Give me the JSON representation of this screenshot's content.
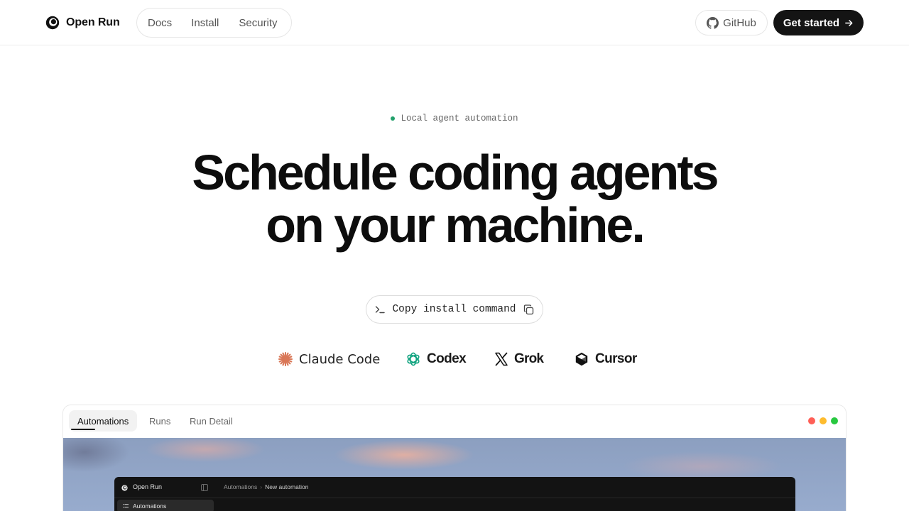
{
  "header": {
    "brand_name": "Open Run",
    "nav": [
      "Docs",
      "Install",
      "Security"
    ],
    "github_label": "GitHub",
    "cta_label": "Get started"
  },
  "hero": {
    "eyebrow": "Local agent automation",
    "headline_line1": "Schedule coding agents",
    "headline_line2": "on your machine.",
    "install_label": "Copy install command"
  },
  "agents": [
    "Claude Code",
    "Codex",
    "Grok",
    "Cursor"
  ],
  "preview": {
    "tabs": [
      "Automations",
      "Runs",
      "Run Detail"
    ],
    "window_dots": [
      "#ff5f57",
      "#febc2e",
      "#28c840"
    ],
    "app": {
      "name": "Open Run",
      "breadcrumb": [
        "Automations",
        "New automation"
      ],
      "sidebar_item": "Automations"
    }
  },
  "colors": {
    "accent_dot": "#22a06b",
    "cta_bg": "#141414",
    "claude": "#d97757",
    "codex": "#10a37f"
  }
}
